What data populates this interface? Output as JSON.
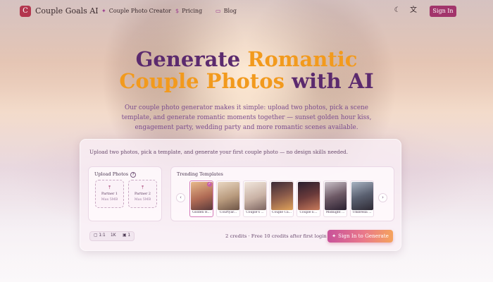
{
  "header": {
    "logo_glyph": "C",
    "brand": "Couple Goals AI",
    "nav": [
      {
        "icon": "sparkle-icon",
        "glyph": "✦",
        "label": "Couple Photo Creator"
      },
      {
        "icon": "dollar-icon",
        "glyph": "$",
        "label": "Pricing"
      },
      {
        "icon": "book-icon",
        "glyph": "▭",
        "label": "Blog"
      }
    ],
    "theme_glyph": "☾",
    "lang_glyph": "文",
    "sign_in": "Sign In"
  },
  "hero": {
    "line1_a": "Generate ",
    "line1_b": "Romantic",
    "line2_a": "Couple Photos ",
    "line2_b": "with AI",
    "subtitle": "Our couple photo generator makes it simple: upload two photos, pick a scene template, and generate romantic moments together — sunset golden hour kiss, engagement party, wedding party and more romantic scenes available.",
    "colors": {
      "purple": "#5b2a6e",
      "orange": "#f29a1d"
    }
  },
  "panel": {
    "hint": "Upload two photos, pick a template, and generate your first couple photo — no design skills needed.",
    "upload": {
      "title": "Upload Photos",
      "help_glyph": "?",
      "slots": [
        {
          "label": "Partner 1",
          "limit": "Max 5MB"
        },
        {
          "label": "Partner 2",
          "limit": "Max 5MB"
        }
      ],
      "upload_glyph": "⤒"
    },
    "templates": {
      "title": "Trending Templates",
      "prev_glyph": "‹",
      "next_glyph": "›",
      "check_glyph": "✓",
      "items": [
        {
          "caption": "Golden H...",
          "selected": true
        },
        {
          "caption": "Courtyar...",
          "selected": false
        },
        {
          "caption": "Couple's ...",
          "selected": false
        },
        {
          "caption": "Couple Ca...",
          "selected": false
        },
        {
          "caption": "Couple E...",
          "selected": false
        },
        {
          "caption": "Midnight ...",
          "selected": false
        },
        {
          "caption": "Umbrella ...",
          "selected": false
        }
      ]
    },
    "options": {
      "ratio": "1:1",
      "resolution": "1K",
      "count": "1"
    },
    "credits": "2 credits · Free 10 credits after first login",
    "generate": {
      "glyph": "✦",
      "label": "Sign In to Generate"
    }
  }
}
